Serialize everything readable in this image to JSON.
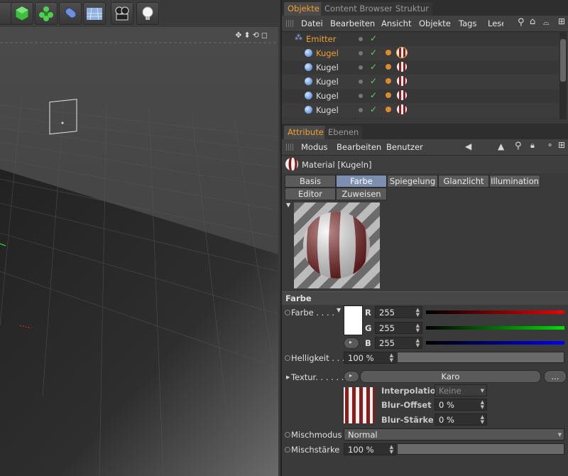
{
  "colors": {
    "accent": "#f0a030",
    "selected_tab": "#7c8fb0"
  },
  "toolbar": {
    "icons": [
      "cube-icon",
      "gear-cloner-icon",
      "capsule-icon",
      "floor-icon",
      "camera-icon",
      "light-bulb-icon"
    ]
  },
  "objects_panel": {
    "tabs": [
      "Objekte",
      "Content Browser",
      "Struktur"
    ],
    "menu": [
      "Datei",
      "Bearbeiten",
      "Ansicht",
      "Objekte",
      "Tags",
      "Lese"
    ],
    "tree": [
      {
        "name": "Emitter",
        "level": 0,
        "highlight": true
      },
      {
        "name": "Kugel",
        "level": 1,
        "highlight": true
      },
      {
        "name": "Kugel",
        "level": 1,
        "highlight": false
      },
      {
        "name": "Kugel",
        "level": 1,
        "highlight": false
      },
      {
        "name": "Kugel",
        "level": 1,
        "highlight": false
      },
      {
        "name": "Kugel",
        "level": 1,
        "highlight": false
      }
    ]
  },
  "attributes_panel": {
    "tabs": [
      "Attribute",
      "Ebenen"
    ],
    "menu": [
      "Modus",
      "Bearbeiten",
      "Benutzer"
    ],
    "title": "Material [Kugeln]",
    "channel_tabs_row1": [
      "Basis",
      "Farbe",
      "Spiegelung",
      "Glanzlicht",
      "Illumination"
    ],
    "channel_tabs_row2": [
      "Editor",
      "Zuweisen"
    ],
    "active_channel": "Farbe",
    "section": "Farbe",
    "color": {
      "label": "Farbe . . . .",
      "r_label": "R",
      "g_label": "G",
      "b_label": "B",
      "r": "255",
      "g": "255",
      "b": "255"
    },
    "brightness": {
      "label": "Helligkeit . . .",
      "value": "100 %",
      "fraction": 1.0
    },
    "texture": {
      "label": "Textur. . . . . .",
      "name": "Karo",
      "more": "...",
      "interp_label": "Interpolation",
      "interp_value": "Keine",
      "blur_offset_label": "Blur-Offset",
      "blur_offset": "0 %",
      "blur_strength_label": "Blur-Stärke",
      "blur_strength": "0 %"
    },
    "mix_mode": {
      "label": "Mischmodus",
      "value": "Normal"
    },
    "mix_strength": {
      "label": "Mischstärke",
      "value": "100 %",
      "fraction": 1.0
    }
  }
}
